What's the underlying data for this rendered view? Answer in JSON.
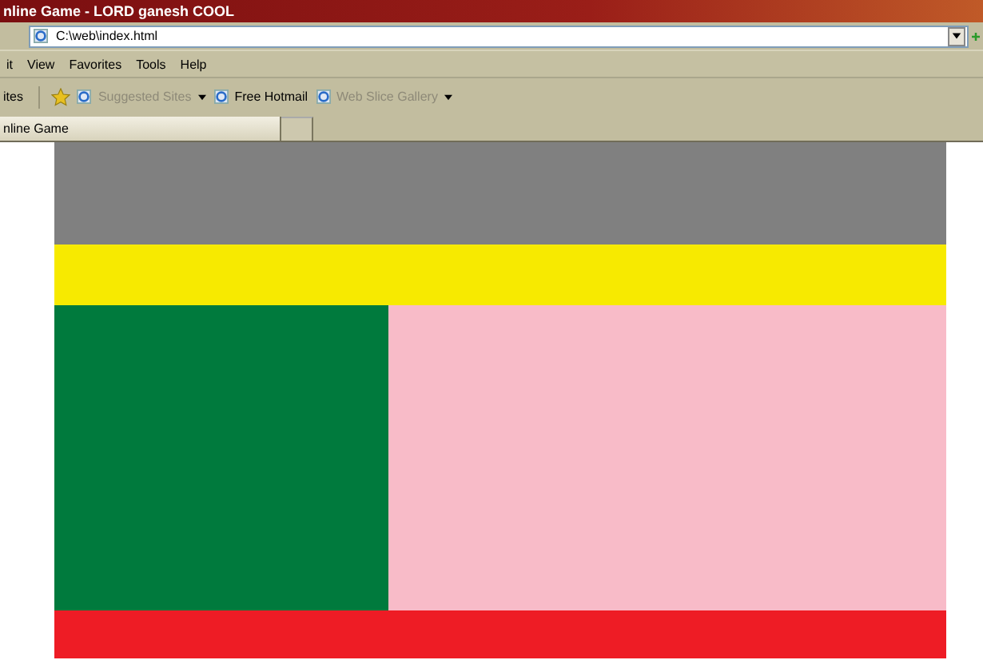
{
  "window": {
    "title": "nline Game - LORD ganesh COOL"
  },
  "address_bar": {
    "value": "C:\\web\\index.html"
  },
  "menu": [
    "it",
    "View",
    "Favorites",
    "Tools",
    "Help"
  ],
  "favorites_bar": {
    "label": "ites",
    "links": [
      {
        "label": "Suggested Sites",
        "disabled": true,
        "dropdown": true
      },
      {
        "label": "Free Hotmail",
        "disabled": false,
        "dropdown": false
      },
      {
        "label": "Web Slice Gallery",
        "disabled": true,
        "dropdown": true
      }
    ]
  },
  "tabs": [
    {
      "label": "nline Game",
      "selected": true
    },
    {
      "selected": false
    }
  ],
  "page": {
    "blocks": [
      {
        "kind": "header",
        "color": "#808080"
      },
      {
        "kind": "nav",
        "color": "#f7ea00"
      },
      {
        "kind": "sidebar",
        "color": "#007a3d"
      },
      {
        "kind": "content",
        "color": "#f8bbc8"
      },
      {
        "kind": "footer",
        "color": "#ee1c25"
      }
    ]
  }
}
